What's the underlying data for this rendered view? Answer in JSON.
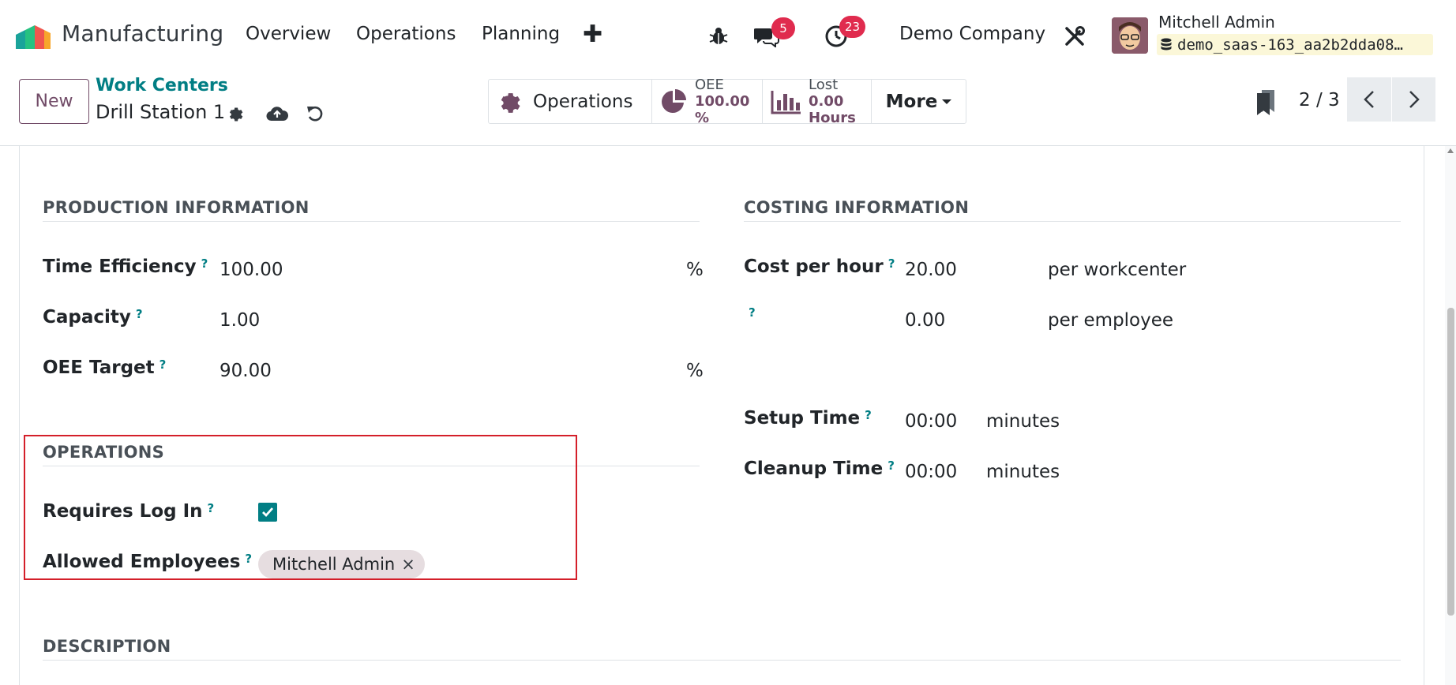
{
  "navbar": {
    "app_name": "Manufacturing",
    "menus": [
      "Overview",
      "Operations",
      "Planning"
    ],
    "plus": "✚",
    "messages_badge": "5",
    "activities_badge": "23",
    "company": "Demo Company",
    "user_name": "Mitchell Admin",
    "database": "demo_saas-163_aa2b2dda08…"
  },
  "control_panel": {
    "new_label": "New",
    "breadcrumb_parent": "Work Centers",
    "breadcrumb_current": "Drill Station 1",
    "smart_buttons": {
      "operations": "Operations",
      "oee_title": "OEE",
      "oee_value": "100.00",
      "oee_unit": "%",
      "lost_title": "Lost",
      "lost_value": "0.00",
      "lost_unit": "Hours",
      "more": "More"
    },
    "pager": "2 / 3"
  },
  "form": {
    "production": {
      "title": "PRODUCTION INFORMATION",
      "time_efficiency_label": "Time Efficiency",
      "time_efficiency_value": "100.00",
      "time_efficiency_unit": "%",
      "capacity_label": "Capacity",
      "capacity_value": "1.00",
      "oee_target_label": "OEE Target",
      "oee_target_value": "90.00",
      "oee_target_unit": "%"
    },
    "costing": {
      "title": "COSTING INFORMATION",
      "cost_per_hour_label": "Cost per hour",
      "cost_per_hour_value": "20.00",
      "cost_per_hour_unit": "per workcenter",
      "employee_cost_value": "0.00",
      "employee_cost_unit": "per employee",
      "setup_time_label": "Setup Time",
      "setup_time_value": "00:00",
      "setup_time_unit": "minutes",
      "cleanup_time_label": "Cleanup Time",
      "cleanup_time_value": "00:00",
      "cleanup_time_unit": "minutes"
    },
    "operations": {
      "title": "OPERATIONS",
      "requires_login_label": "Requires Log In",
      "requires_login_checked": true,
      "allowed_employees_label": "Allowed Employees",
      "allowed_employees": [
        "Mitchell Admin"
      ]
    },
    "description": {
      "title": "DESCRIPTION"
    },
    "help_marker": "?"
  },
  "colors": {
    "brand": "#714b67",
    "teal": "#017e84",
    "badge": "#e02b4e",
    "highlight": "#d41f2a"
  }
}
